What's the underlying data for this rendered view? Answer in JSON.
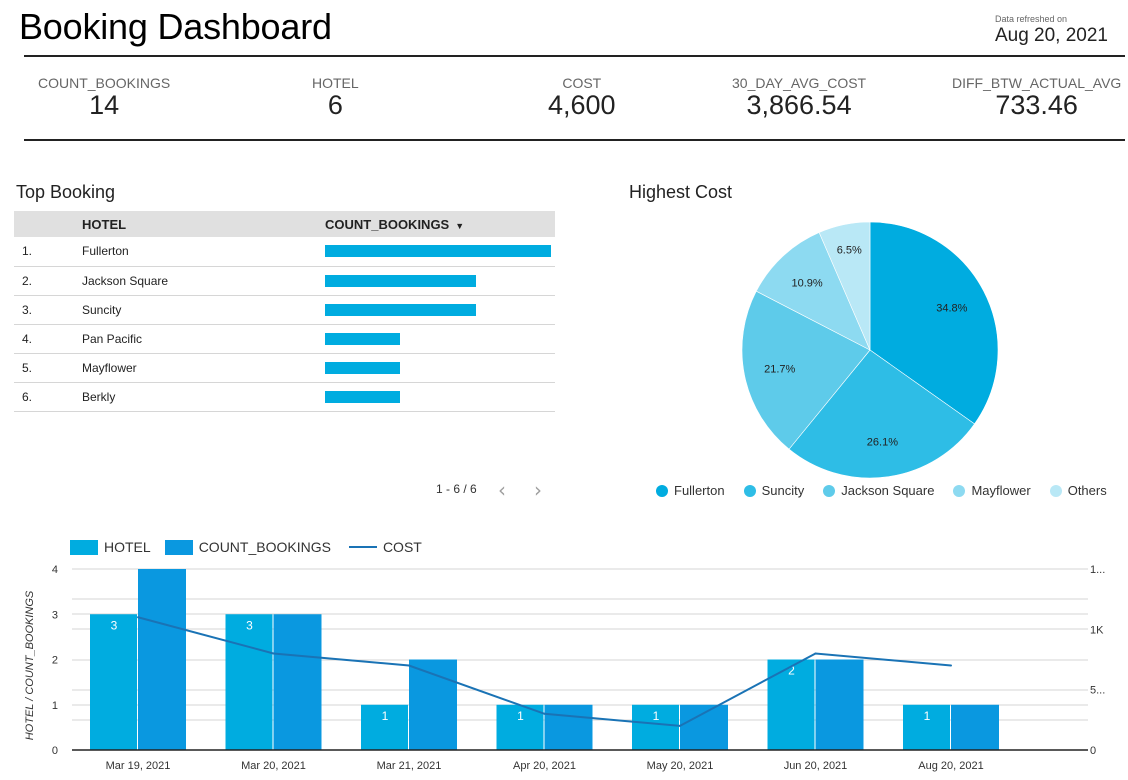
{
  "header": {
    "title": "Booking Dashboard",
    "refresh_label": "Data refreshed on",
    "refresh_date": "Aug 20, 2021"
  },
  "kpis": [
    {
      "label": "COUNT_BOOKINGS",
      "value": "14"
    },
    {
      "label": "HOTEL",
      "value": "6"
    },
    {
      "label": "COST",
      "value": "4,600"
    },
    {
      "label": "30_DAY_AVG_COST",
      "value": "3,866.54"
    },
    {
      "label": "DIFF_BTW_ACTUAL_AVG",
      "value": "733.46"
    }
  ],
  "top_booking": {
    "title": "Top Booking",
    "columns": [
      "HOTEL",
      "COUNT_BOOKINGS"
    ],
    "sort_icon": "sort-desc-icon",
    "rows": [
      {
        "rank": "1.",
        "hotel": "Fullerton",
        "count": 3
      },
      {
        "rank": "2.",
        "hotel": "Jackson Square",
        "count": 2
      },
      {
        "rank": "3.",
        "hotel": "Suncity",
        "count": 2
      },
      {
        "rank": "4.",
        "hotel": "Pan Pacific",
        "count": 1
      },
      {
        "rank": "5.",
        "hotel": "Mayflower",
        "count": 1
      },
      {
        "rank": "6.",
        "hotel": "Berkly",
        "count": 1
      }
    ],
    "max_count": 3,
    "pager_text": "1 - 6 / 6",
    "prev_icon": "‹",
    "next_icon": "›",
    "bar_color": "#00ace0"
  },
  "chart_data": [
    {
      "type": "pie",
      "title": "Highest Cost",
      "legend_position": "bottom",
      "slices": [
        {
          "label": "Fullerton",
          "value": 34.8,
          "display": "34.8%",
          "color": "#00ace0"
        },
        {
          "label": "Suncity",
          "value": 26.1,
          "display": "26.1%",
          "color": "#2ebde6"
        },
        {
          "label": "Jackson Square",
          "value": 21.7,
          "display": "21.7%",
          "color": "#5ecbea"
        },
        {
          "label": "Mayflower",
          "value": 10.9,
          "display": "10.9%",
          "color": "#8ddaf1"
        },
        {
          "label": "Others",
          "value": 6.5,
          "display": "6.5%",
          "color": "#b9e8f6"
        }
      ]
    },
    {
      "type": "bar",
      "title": "",
      "legend_position": "top-left",
      "categories": [
        "Mar 19, 2021",
        "Mar 20, 2021",
        "Mar 21, 2021",
        "Apr 20, 2021",
        "May 20, 2021",
        "Jun 20, 2021",
        "Aug 20, 2021"
      ],
      "series": [
        {
          "name": "HOTEL",
          "kind": "bar",
          "axis": "left",
          "color": "#00ace0",
          "values": [
            3,
            3,
            1,
            1,
            1,
            2,
            1
          ],
          "labels_shown": true
        },
        {
          "name": "COUNT_BOOKINGS",
          "kind": "bar",
          "axis": "left",
          "color": "#0a98e0",
          "values": [
            4,
            3,
            2,
            1,
            1,
            2,
            1
          ],
          "labels_shown": false
        },
        {
          "name": "COST",
          "kind": "line",
          "axis": "right",
          "color": "#1a73b5",
          "values": [
            1100,
            800,
            700,
            300,
            200,
            800,
            700
          ]
        }
      ],
      "ylabel": "HOTEL / COUNT_BOOKINGS",
      "ylim": [
        0,
        4
      ],
      "yticks": [
        "0",
        "1",
        "2",
        "3",
        "4"
      ],
      "y2lim": [
        0,
        1500
      ],
      "y2ticks": [
        {
          "value": 0,
          "label": "0"
        },
        {
          "value": 500,
          "label": "5..."
        },
        {
          "value": 1000,
          "label": "1K"
        },
        {
          "value": 1500,
          "label": "1..."
        }
      ],
      "grid": true
    }
  ]
}
